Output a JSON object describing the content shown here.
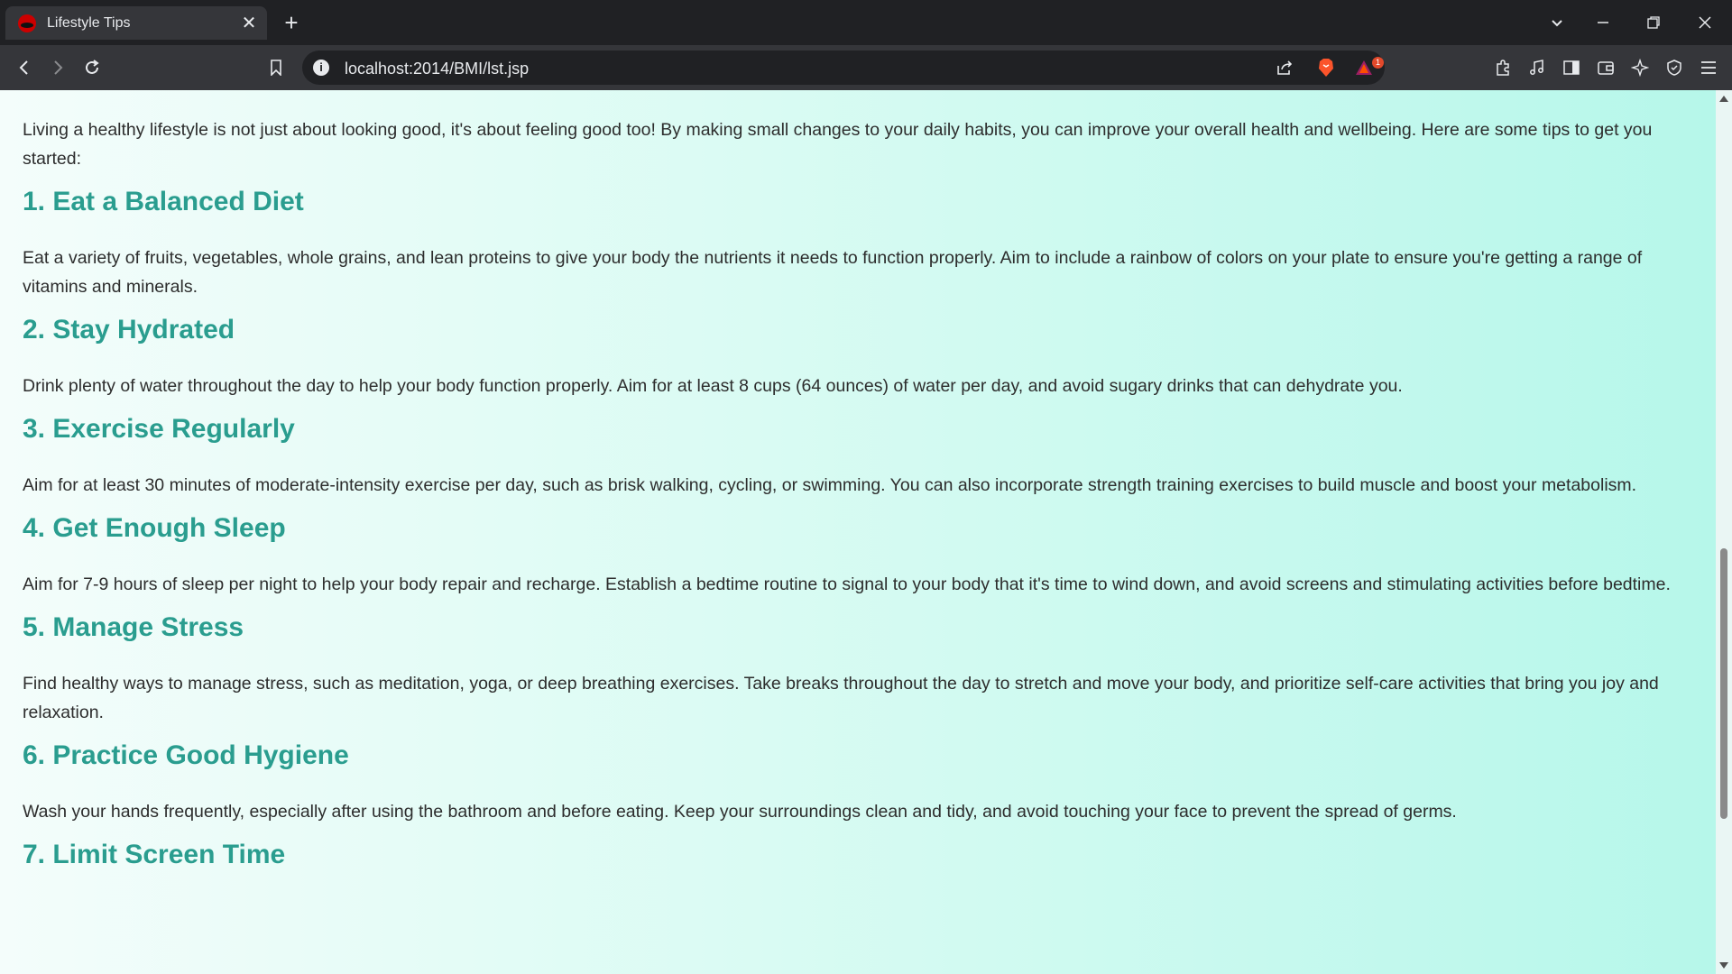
{
  "browser": {
    "tab_title": "Lifestyle Tips",
    "url": "localhost:2014/BMI/lst.jsp",
    "badge_count": "1"
  },
  "page": {
    "intro": "Living a healthy lifestyle is not just about looking good, it's about feeling good too! By making small changes to your daily habits, you can improve your overall health and wellbeing. Here are some tips to get you started:",
    "tips": [
      {
        "heading": "1. Eat a Balanced Diet",
        "text": "Eat a variety of fruits, vegetables, whole grains, and lean proteins to give your body the nutrients it needs to function properly. Aim to include a rainbow of colors on your plate to ensure you're getting a range of vitamins and minerals."
      },
      {
        "heading": "2. Stay Hydrated",
        "text": "Drink plenty of water throughout the day to help your body function properly. Aim for at least 8 cups (64 ounces) of water per day, and avoid sugary drinks that can dehydrate you."
      },
      {
        "heading": "3. Exercise Regularly",
        "text": "Aim for at least 30 minutes of moderate-intensity exercise per day, such as brisk walking, cycling, or swimming. You can also incorporate strength training exercises to build muscle and boost your metabolism."
      },
      {
        "heading": "4. Get Enough Sleep",
        "text": "Aim for 7-9 hours of sleep per night to help your body repair and recharge. Establish a bedtime routine to signal to your body that it's time to wind down, and avoid screens and stimulating activities before bedtime."
      },
      {
        "heading": "5. Manage Stress",
        "text": "Find healthy ways to manage stress, such as meditation, yoga, or deep breathing exercises. Take breaks throughout the day to stretch and move your body, and prioritize self-care activities that bring you joy and relaxation."
      },
      {
        "heading": "6. Practice Good Hygiene",
        "text": "Wash your hands frequently, especially after using the bathroom and before eating. Keep your surroundings clean and tidy, and avoid touching your face to prevent the spread of germs."
      },
      {
        "heading": "7. Limit Screen Time",
        "text": ""
      }
    ]
  },
  "colors": {
    "heading": "#2a9d8f",
    "body_text": "#2d2d2d"
  }
}
